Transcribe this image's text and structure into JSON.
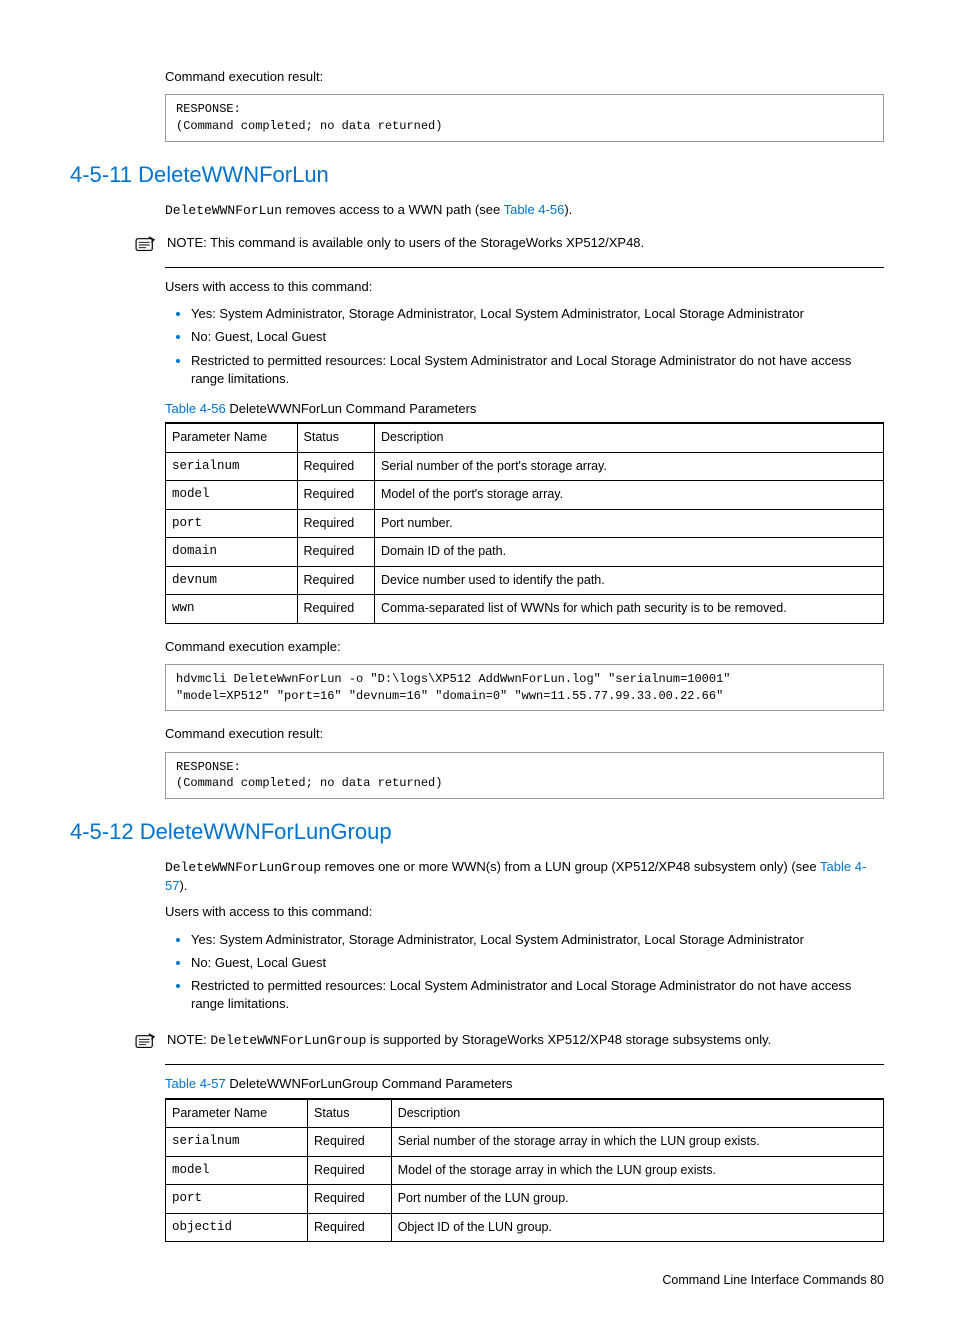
{
  "s1": {
    "exec_result_label": "Command execution result:",
    "exec_result_code": "RESPONSE:\n(Command completed; no data returned)"
  },
  "sec11": {
    "heading": "4-5-11 DeleteWWNForLun",
    "intro_cmd": "DeleteWWNForLun",
    "intro_rest": " removes access to a WWN path (see ",
    "intro_link": "Table 4-56",
    "intro_end": ").",
    "note_label": "NOTE:",
    "note_text": "  This command is available only to users of the StorageWorks XP512/XP48.",
    "users_label": "Users with access to this command:",
    "bullets": [
      "Yes: System Administrator, Storage Administrator, Local System Administrator, Local Storage Administrator",
      "No: Guest, Local Guest",
      "Restricted to permitted resources: Local System Administrator and Local Storage Administrator do not have access range limitations."
    ],
    "table_caption_link": "Table 4-56",
    "table_caption_rest": "  DeleteWWNForLun Command Parameters",
    "table_headers": [
      "Parameter Name",
      "Status",
      "Description"
    ],
    "rows": [
      {
        "p": "serialnum",
        "s": "Required",
        "d": "Serial number of the port's storage array."
      },
      {
        "p": "model",
        "s": "Required",
        "d": "Model of the port's storage array."
      },
      {
        "p": "port",
        "s": "Required",
        "d": "Port number."
      },
      {
        "p": "domain",
        "s": "Required",
        "d": "Domain ID of the path."
      },
      {
        "p": "devnum",
        "s": "Required",
        "d": "Device number used to identify the path."
      },
      {
        "p": "wwn",
        "s": "Required",
        "d": "Comma-separated list of WWNs for which path security is to be removed."
      }
    ],
    "exec_example_label": "Command execution example:",
    "exec_example_code": "hdvmcli DeleteWwnForLun -o \"D:\\logs\\XP512 AddWwnForLun.log\" \"serialnum=10001\"\n\"model=XP512\" \"port=16\" \"devnum=16\" \"domain=0\" \"wwn=11.55.77.99.33.00.22.66\"",
    "exec_result_label": "Command execution result:",
    "exec_result_code": "RESPONSE:\n(Command completed; no data returned)"
  },
  "sec12": {
    "heading": "4-5-12 DeleteWWNForLunGroup",
    "intro_cmd": "DeleteWWNForLunGroup",
    "intro_rest1": " removes one or more WWN(s) from a LUN group (XP512/XP48 subsystem only) (see ",
    "intro_link": "Table 4-57",
    "intro_end": ").",
    "users_label": "Users with access to this command:",
    "bullets": [
      "Yes: System Administrator, Storage Administrator, Local System Administrator, Local Storage Administrator",
      "No: Guest, Local Guest",
      "Restricted to permitted resources: Local System Administrator and Local Storage Administrator do not have access range limitations."
    ],
    "note_label": "NOTE:",
    "note_cmd": "DeleteWWNForLunGroup",
    "note_text": " is supported by StorageWorks XP512/XP48 storage subsystems only.",
    "table_caption_link": "Table 4-57",
    "table_caption_rest": "  DeleteWWNForLunGroup Command Parameters",
    "table_headers": [
      "Parameter Name",
      "Status",
      "Description"
    ],
    "rows": [
      {
        "p": "serialnum",
        "s": "Required",
        "d": "Serial number of the storage array in which the LUN group exists."
      },
      {
        "p": "model",
        "s": "Required",
        "d": "Model of the storage array in which the LUN group exists."
      },
      {
        "p": "port",
        "s": "Required",
        "d": "Port number of the LUN group."
      },
      {
        "p": "objectid",
        "s": "Required",
        "d": "Object ID of the LUN group."
      }
    ]
  },
  "footer": {
    "text": "Command Line Interface Commands   80"
  }
}
